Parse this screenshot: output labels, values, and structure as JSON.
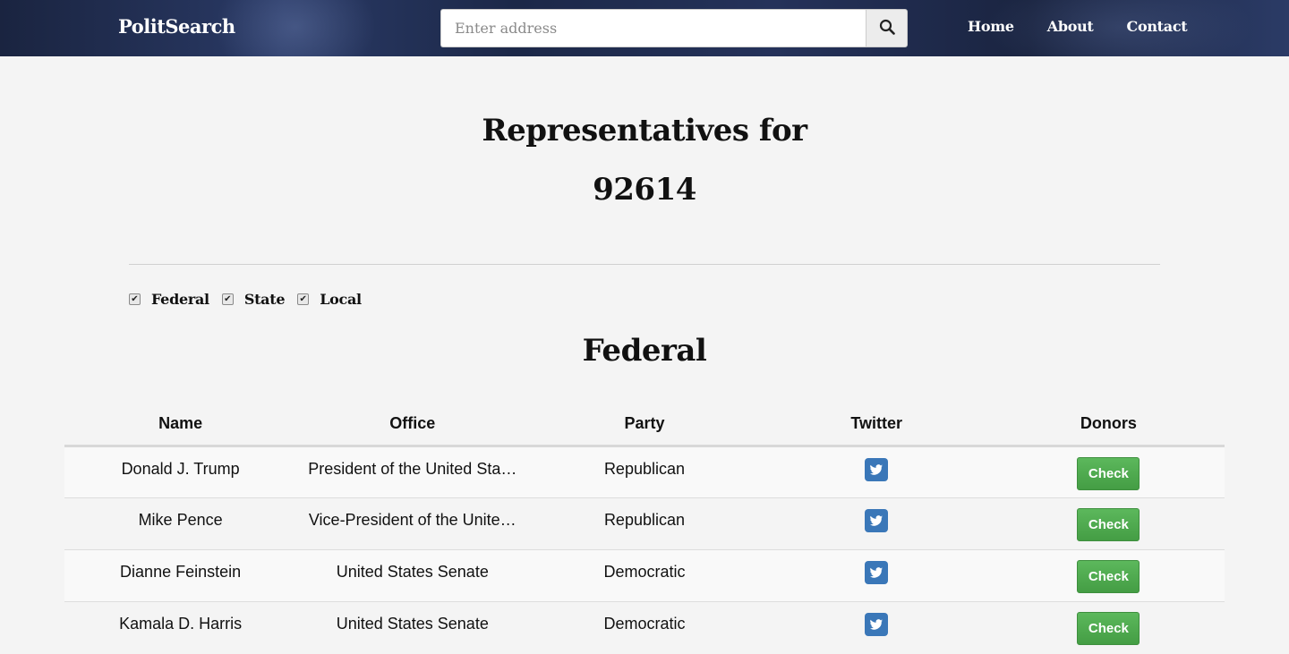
{
  "header": {
    "brand": "PolitSearch",
    "search": {
      "placeholder": "Enter address",
      "value": ""
    },
    "search_icon": "search-icon",
    "nav": [
      "Home",
      "About",
      "Contact"
    ]
  },
  "main": {
    "title_line1": "Representatives for",
    "title_line2": "92614",
    "filters": [
      {
        "label": "Federal",
        "checked": true
      },
      {
        "label": "State",
        "checked": true
      },
      {
        "label": "Local",
        "checked": true
      }
    ],
    "section_title": "Federal",
    "table": {
      "headers": [
        "Name",
        "Office",
        "Party",
        "Twitter",
        "Donors"
      ],
      "rows": [
        {
          "name": "Donald J. Trump",
          "office": "President of the United Sta…",
          "party": "Republican",
          "twitter_icon": "twitter-icon",
          "donors_button": "Check"
        },
        {
          "name": "Mike Pence",
          "office": "Vice-President of the Unite…",
          "party": "Republican",
          "twitter_icon": "twitter-icon",
          "donors_button": "Check"
        },
        {
          "name": "Dianne Feinstein",
          "office": "United States Senate",
          "party": "Democratic",
          "twitter_icon": "twitter-icon",
          "donors_button": "Check"
        },
        {
          "name": "Kamala D. Harris",
          "office": "United States Senate",
          "party": "Democratic",
          "twitter_icon": "twitter-icon",
          "donors_button": "Check"
        }
      ]
    }
  },
  "colors": {
    "navbar": "#1c2848",
    "check_button": "#5cb85c",
    "twitter_icon": "#3a77b8"
  }
}
